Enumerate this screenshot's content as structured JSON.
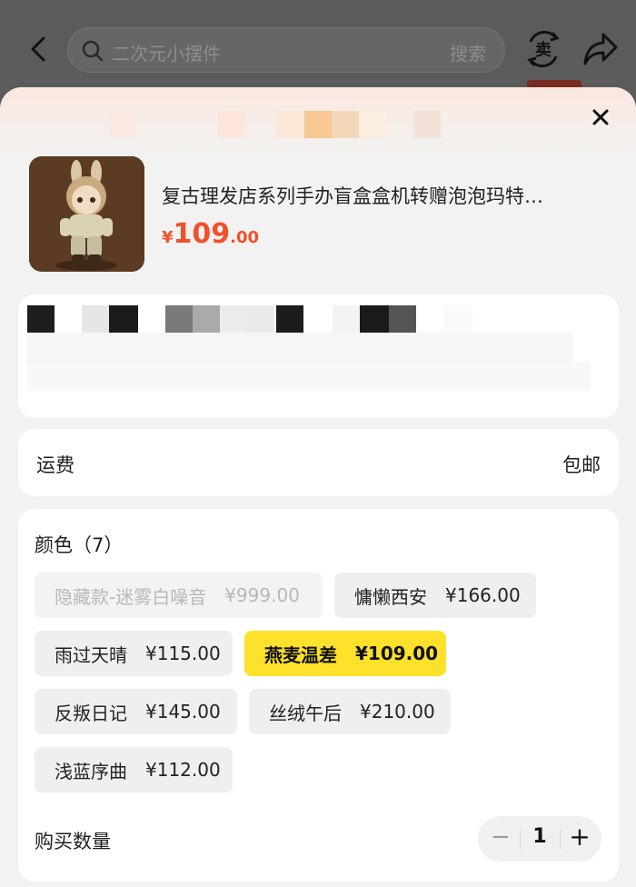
{
  "search": {
    "placeholder": "二次元小摆件",
    "button_label": "搜索"
  },
  "header": {
    "sell_icon": "sell-icon",
    "share_icon": "share-icon",
    "back_icon": "back-arrow-icon"
  },
  "product": {
    "title": "复古理发店系列手办盲盒盒机转赠泡泡玛特…",
    "price_currency": "¥",
    "price_integer": "109",
    "price_decimal": ".00"
  },
  "shipping": {
    "label": "运费",
    "value": "包邮"
  },
  "options": {
    "title": "颜色（7）",
    "items": [
      {
        "name": "隐藏款-迷雾白噪音",
        "price": "¥999.00",
        "state": "disabled"
      },
      {
        "name": "慵懒西安",
        "price": "¥166.00",
        "state": "normal"
      },
      {
        "name": "雨过天晴",
        "price": "¥115.00",
        "state": "normal"
      },
      {
        "name": "燕麦温差",
        "price": "¥109.00",
        "state": "selected"
      },
      {
        "name": "反叛日记",
        "price": "¥145.00",
        "state": "normal"
      },
      {
        "name": "丝绒午后",
        "price": "¥210.00",
        "state": "normal"
      },
      {
        "name": "浅蓝序曲",
        "price": "¥112.00",
        "state": "normal"
      }
    ]
  },
  "quantity": {
    "label": "购买数量",
    "value": "1",
    "minus": "−",
    "plus": "+"
  },
  "colors": {
    "accent_price": "#f2502b",
    "selected_chip": "#fde12a"
  }
}
